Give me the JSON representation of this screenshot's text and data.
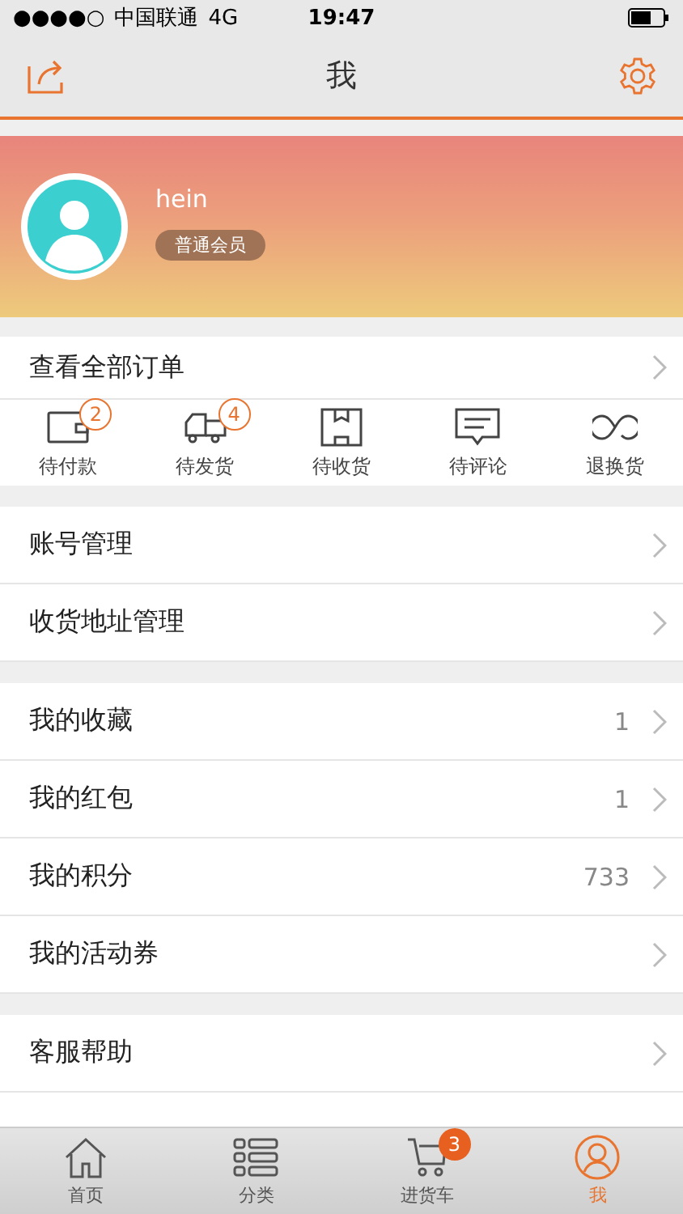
{
  "status_bar": {
    "signal_dots": "●●●●○",
    "carrier": "中国联通",
    "network": "4G",
    "time": "19:47"
  },
  "nav_bar": {
    "title": "我"
  },
  "profile": {
    "username": "hein",
    "member_level": "普通会员"
  },
  "orders": {
    "label": "查看全部订单",
    "statuses": [
      {
        "kind": "wallet",
        "label": "待付款",
        "count": "2"
      },
      {
        "kind": "truck",
        "label": "待发货",
        "count": "4"
      },
      {
        "kind": "box",
        "label": "待收货"
      },
      {
        "kind": "comment",
        "label": "待评论"
      },
      {
        "kind": "exchange",
        "label": "退换货"
      }
    ]
  },
  "menu_groups": [
    {
      "items": [
        {
          "label": "账号管理"
        },
        {
          "label": "收货地址管理"
        }
      ]
    },
    {
      "items": [
        {
          "label": "我的收藏",
          "value": "1"
        },
        {
          "label": "我的红包",
          "value": "1"
        },
        {
          "label": "我的积分",
          "value": "733"
        },
        {
          "label": "我的活动券"
        }
      ]
    },
    {
      "items": [
        {
          "label": "客服帮助"
        }
      ]
    }
  ],
  "tab_bar": [
    {
      "kind": "home",
      "label": "首页",
      "selected": false
    },
    {
      "kind": "category",
      "label": "分类",
      "selected": false
    },
    {
      "kind": "cart",
      "label": "进货车",
      "selected": false,
      "badge": "3"
    },
    {
      "kind": "me",
      "label": "我",
      "selected": true
    }
  ]
}
